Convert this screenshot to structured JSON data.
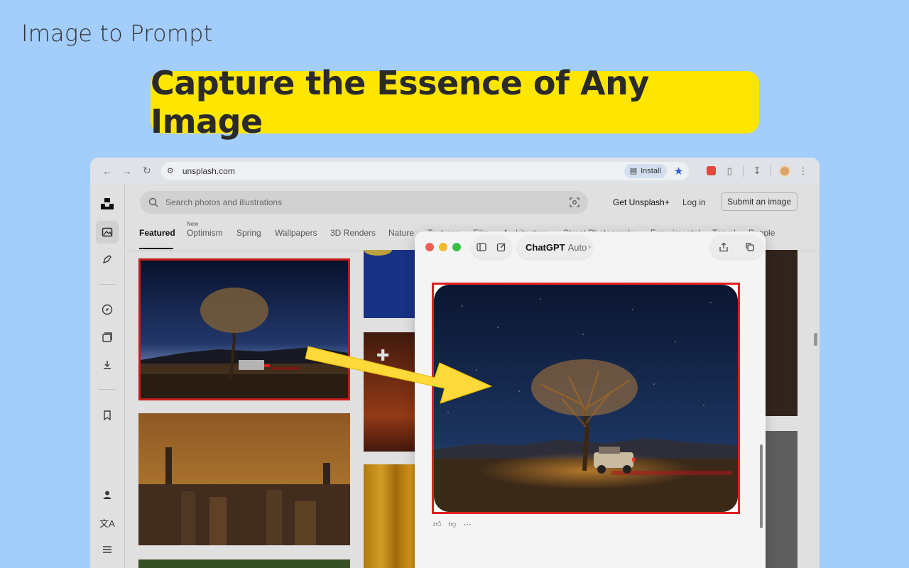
{
  "app_title": "Image to Prompt",
  "banner": "Capture the Essence of Any Image",
  "browser": {
    "url": "unsplash.com",
    "install_label": "Install"
  },
  "unsplash": {
    "search_placeholder": "Search photos and illustrations",
    "get_plus": "Get Unsplash+",
    "login": "Log in",
    "submit": "Submit an image",
    "tabs": [
      "Featured",
      "Optimism",
      "Spring",
      "Wallpapers",
      "3D Renders",
      "Nature",
      "Textures",
      "Film",
      "Architecture",
      "Street Photography",
      "Experimental",
      "Travel",
      "People"
    ],
    "new_badge": "New",
    "active_tab": "Featured"
  },
  "chatgpt": {
    "title": "ChatGPT",
    "model": "Auto"
  },
  "colors": {
    "background": "#a3cdfb",
    "banner": "#ffe600",
    "highlight": "#e02020",
    "arrow": "#ffd93a"
  }
}
